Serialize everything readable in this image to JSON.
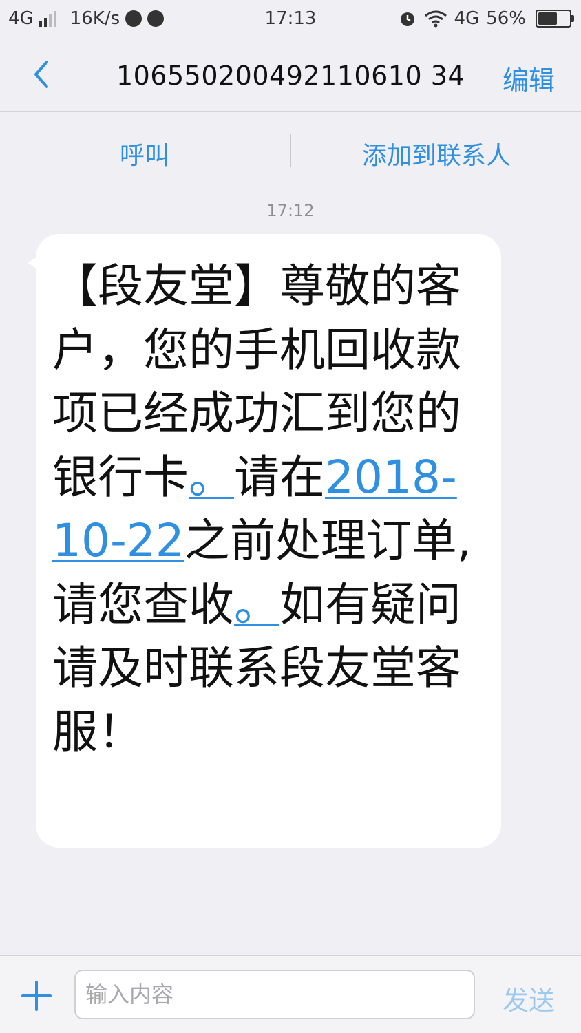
{
  "status_bar": {
    "network": "4G",
    "speed": "16K/s",
    "time": "17:13",
    "network_right": "4G",
    "battery_percent": "56%",
    "battery_level": 0.56
  },
  "header": {
    "title": "106550200492110610 34",
    "edit_label": "编辑"
  },
  "actions": {
    "call_label": "呼叫",
    "add_contact_label": "添加到联系人"
  },
  "message": {
    "timestamp": "17:12",
    "text_before_1": "【段友堂】尊敬的客户，您的手机回收款项已经成功汇到您的银行卡",
    "link_1": "。",
    "text_mid_1": "请在",
    "link_date": "2018-10-22",
    "text_mid_2": "之前处理订单,请您查收",
    "link_2": "。",
    "text_after": "如有疑问请及时联系段友堂客服！"
  },
  "input_bar": {
    "placeholder": "输入内容",
    "send_label": "发送"
  },
  "colors": {
    "accent": "#2f8fe0",
    "background": "#efeff4",
    "bubble": "#ffffff"
  }
}
